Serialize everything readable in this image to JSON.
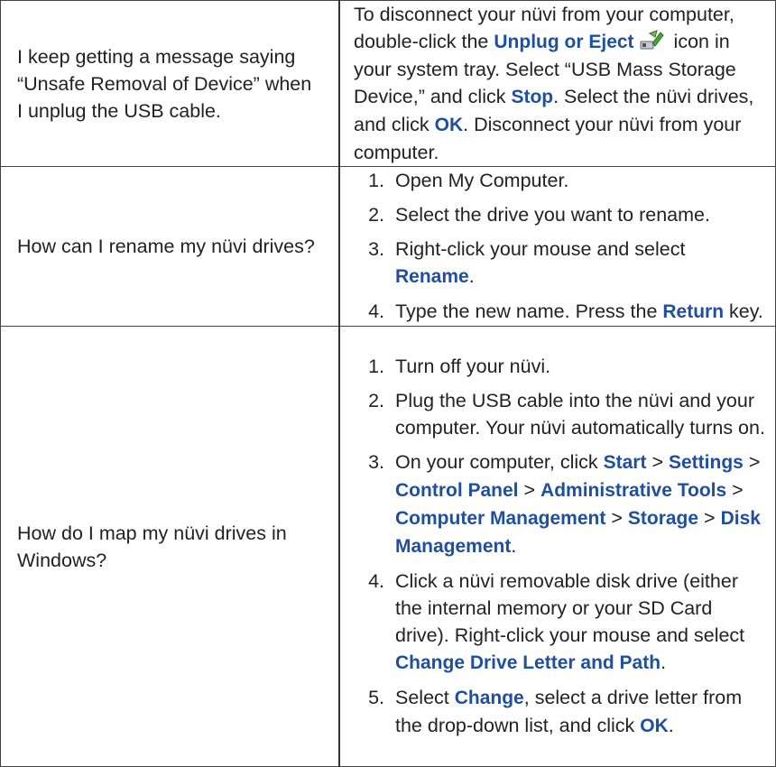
{
  "colors": {
    "keyword": "#1f4fa0",
    "text": "#222222",
    "border": "#444444"
  },
  "rows": [
    {
      "question": "I keep getting a message saying “Unsafe Removal of Device” when I unplug the USB cable.",
      "answer": {
        "t1": "To disconnect your nüvi from your computer, double-click the ",
        "k1": "Unplug or Eject",
        "icon": "usb-eject-icon",
        "t2": " icon in your system tray. Select “USB Mass Storage Device,” and click ",
        "k2": "Stop",
        "t3": ". Select the nüvi drives, and click ",
        "k3": "OK",
        "t4": ". Disconnect your nüvi from your computer."
      }
    },
    {
      "question": "How can I rename my nüvi drives?",
      "steps": [
        {
          "num": "1.",
          "t1": "Open My Computer."
        },
        {
          "num": "2.",
          "t1": "Select the drive you want to rename."
        },
        {
          "num": "3.",
          "t1": "Right-click your mouse and select ",
          "k1": "Rename",
          "t2": "."
        },
        {
          "num": "4.",
          "t1": "Type the new name. Press the ",
          "k1": "Return",
          "t2": " key."
        }
      ]
    },
    {
      "question": "How do I map my nüvi drives in Windows?",
      "steps": [
        {
          "num": "1.",
          "t1": "Turn off your nüvi."
        },
        {
          "num": "2.",
          "t1": "Plug the USB cable into the nüvi and your computer. Your nüvi automatically turns on."
        },
        {
          "num": "3.",
          "t1": "On your computer, click ",
          "k1": "Start",
          "t2": " > ",
          "k2": "Settings",
          "t3": " > ",
          "k3": "Control Panel",
          "t4": " > ",
          "k4": "Administrative Tools",
          "t5": " > ",
          "k5": "Computer Management",
          "t6": " > ",
          "k6": "Storage",
          "t7": " > ",
          "k7": "Disk Management",
          "t8": "."
        },
        {
          "num": "4.",
          "t1": "Click a nüvi removable disk drive (either the internal memory or your SD Card drive). Right-click your mouse and select ",
          "k1": "Change Drive Letter and Path",
          "t2": "."
        },
        {
          "num": "5.",
          "t1": "Select ",
          "k1": "Change",
          "t2": ", select a drive letter from the drop-down list, and click ",
          "k2": "OK",
          "t3": "."
        }
      ]
    }
  ]
}
